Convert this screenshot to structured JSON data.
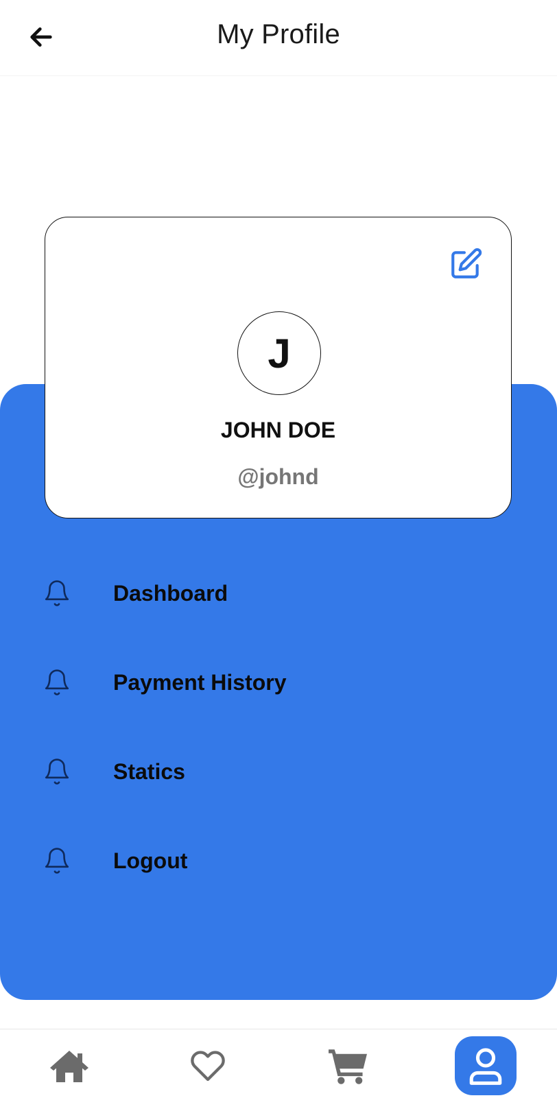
{
  "header": {
    "title": "My Profile",
    "back_icon": "arrow-left-icon"
  },
  "profile": {
    "avatar_initial": "J",
    "name": "JOHN DOE",
    "handle": "@johnd",
    "edit_icon": "edit-icon"
  },
  "menu": {
    "items": [
      {
        "label": "Dashboard",
        "icon": "bell-icon"
      },
      {
        "label": "Payment History",
        "icon": "bell-icon"
      },
      {
        "label": "Statics",
        "icon": "bell-icon"
      },
      {
        "label": "Logout",
        "icon": "bell-icon"
      }
    ]
  },
  "bottom_nav": {
    "items": [
      {
        "icon": "home-icon",
        "active": false
      },
      {
        "icon": "heart-icon",
        "active": false
      },
      {
        "icon": "cart-icon",
        "active": false
      },
      {
        "icon": "user-icon",
        "active": true
      }
    ]
  },
  "colors": {
    "accent": "#3479e8",
    "text": "#111111",
    "muted": "#767676",
    "nav_icon": "#6b6b6b"
  }
}
